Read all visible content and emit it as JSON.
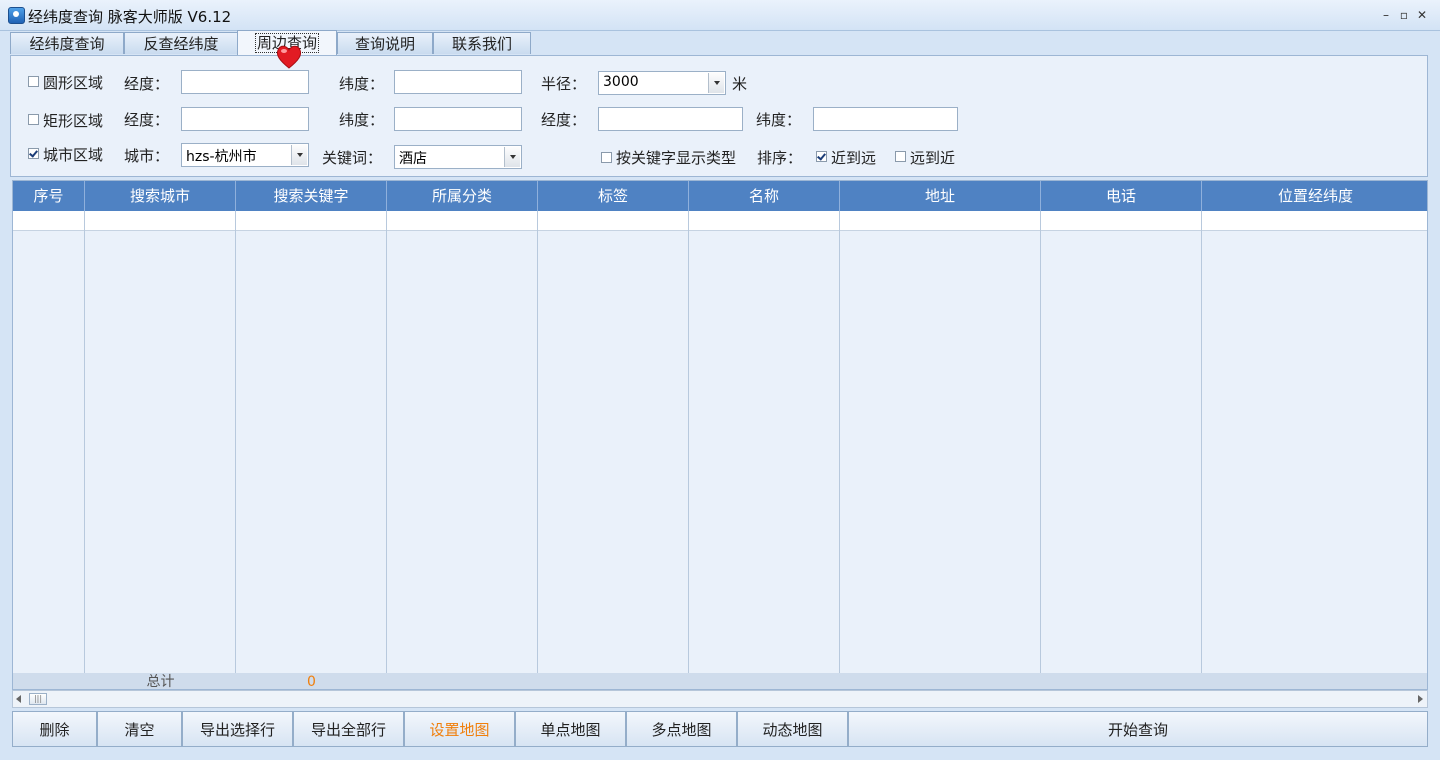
{
  "window": {
    "title": "经纬度查询 脉客大师版 V6.12"
  },
  "tabs": [
    {
      "label": "经纬度查询"
    },
    {
      "label": "反查经纬度"
    },
    {
      "label": "周边查询",
      "active": true
    },
    {
      "label": "查询说明"
    },
    {
      "label": "联系我们"
    }
  ],
  "form": {
    "circle": {
      "checkbox_label": "圆形区域",
      "checked": false,
      "lng_label": "经度：",
      "lng_value": "",
      "lat_label": "纬度：",
      "lat_value": "",
      "radius_label": "半径：",
      "radius_value": "3000",
      "radius_unit": "米"
    },
    "rect": {
      "checkbox_label": "矩形区域",
      "checked": false,
      "lng1_label": "经度：",
      "lng1_value": "",
      "lat1_label": "纬度：",
      "lat1_value": "",
      "lng2_label": "经度：",
      "lng2_value": "",
      "lat2_label": "纬度：",
      "lat2_value": ""
    },
    "city": {
      "checkbox_label": "城市区域",
      "checked": true,
      "city_label": "城市：",
      "city_value": "hzs-杭州市",
      "keyword_label": "关键词：",
      "keyword_value": "酒店",
      "show_type_label": "按关键字显示类型",
      "show_type_checked": false,
      "sort_label": "排序：",
      "near_to_far_label": "近到远",
      "near_to_far_checked": true,
      "far_to_near_label": "远到近",
      "far_to_near_checked": false
    }
  },
  "table": {
    "columns": [
      "序号",
      "搜索城市",
      "搜索关键字",
      "所属分类",
      "标签",
      "名称",
      "地址",
      "电话",
      "位置经纬度"
    ],
    "rows": [],
    "footer": {
      "total_label": "总计",
      "total_value": "0"
    }
  },
  "buttons": {
    "delete": "删除",
    "clear": "清空",
    "export_selected": "导出选择行",
    "export_all": "导出全部行",
    "set_map": "设置地图",
    "single_map": "单点地图",
    "multi_map": "多点地图",
    "dynamic_map": "动态地图",
    "start_query": "开始查询"
  },
  "colors": {
    "accent": "#f07f0c",
    "header_bg": "#4f82c3",
    "window_bg": "#d5e4f5"
  }
}
